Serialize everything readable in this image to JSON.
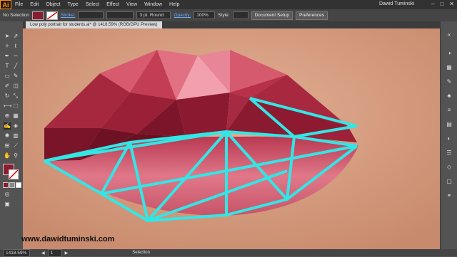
{
  "app": {
    "logo_text": "Ai"
  },
  "menubar": {
    "items": [
      "File",
      "Edit",
      "Object",
      "Type",
      "Select",
      "Effect",
      "View",
      "Window",
      "Help"
    ],
    "user": "Dawid Tuminski"
  },
  "control_bar": {
    "selection": "No Selection",
    "stroke_label": "Stroke:",
    "brush": "3 pt. Round",
    "opacity_label": "Opacity:",
    "opacity_value": "100%",
    "style_label": "Style:",
    "doc_setup": "Document Setup",
    "preferences": "Preferences"
  },
  "document": {
    "tab_title": "Low poly portrait for students.ai* @ 1418.59% (RGB/GPU Preview)"
  },
  "status": {
    "zoom": "1418.59%",
    "page": "1",
    "tool": "Selection"
  },
  "watermark": "www.dawidtuminski.com",
  "colors": {
    "accent": "#33e6e6",
    "lip_dark": "#8a1c30",
    "lip_mid": "#c23a56",
    "skin": "#d59a7c"
  }
}
